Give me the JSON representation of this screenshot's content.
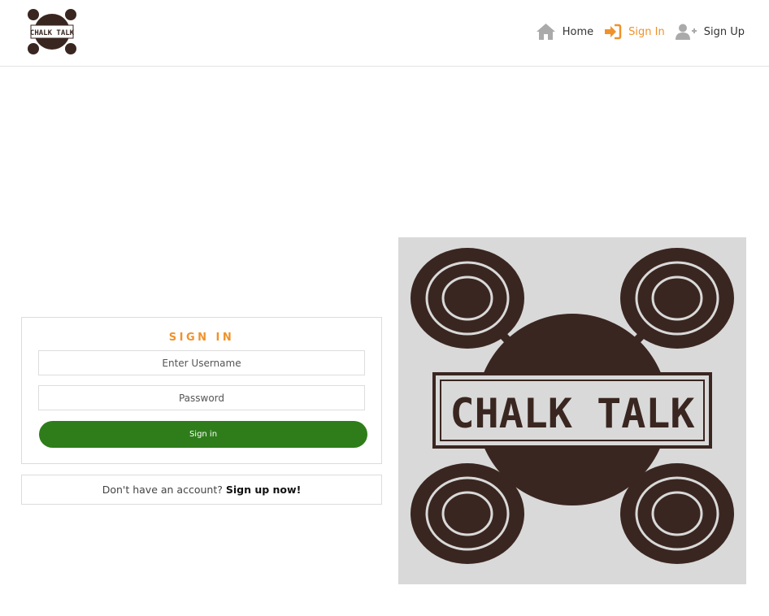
{
  "brand": {
    "logo_text": "CHALK TALK",
    "brown": "#3a2620",
    "accent": "#f0922b",
    "green": "#2e7d1a"
  },
  "nav": {
    "home_label": "Home",
    "signin_label": "Sign In",
    "signup_label": "Sign Up",
    "icons": [
      "home-icon",
      "sign-in-icon",
      "user-plus-icon"
    ]
  },
  "signin": {
    "title": "SIGN IN",
    "username_placeholder": "Enter Username",
    "password_placeholder": "Password",
    "button_label": "Sign in"
  },
  "signup_prompt": {
    "text": "Don't have an account?",
    "link": "Sign up now!"
  },
  "hero": {
    "text": "CHALK TALK"
  }
}
